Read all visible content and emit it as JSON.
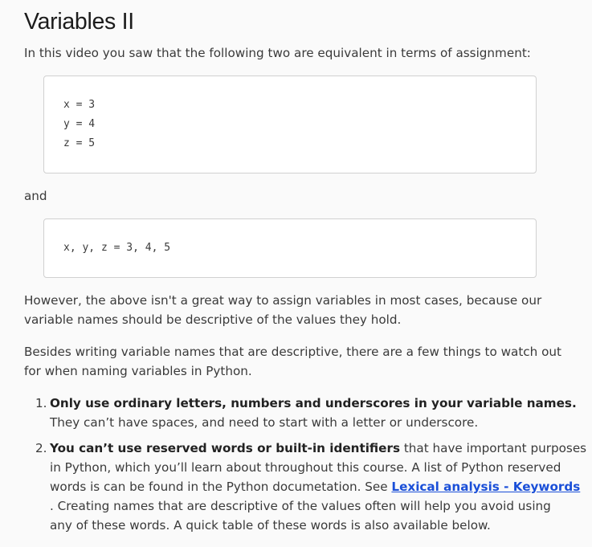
{
  "title": "Variables II",
  "intro": "In this video you saw that the following two are equivalent in terms of assignment:",
  "code_block_1": [
    "x = 3",
    "y = 4",
    "z = 5"
  ],
  "and_text": "and",
  "code_block_2": [
    "x, y, z = 3, 4, 5"
  ],
  "para_however": [
    "However, the above isn't a great way to assign variables in most cases, because our",
    "variable names should be descriptive of the values they hold."
  ],
  "para_besides": [
    "Besides writing variable names that are descriptive, there are a few things to watch out",
    "for when naming variables in Python."
  ],
  "list": {
    "item1": {
      "number": "1.",
      "bold": "Only use ordinary letters, numbers and underscores in your variable names.",
      "line2": "They can’t have spaces, and need to start with a letter or underscore."
    },
    "item2": {
      "number": "2.",
      "bold": "You can’t use reserved words or built-in identifiers",
      "line1_rest": " that have important purposes",
      "line2": "in Python, which you’ll learn about throughout this course. A list of Python reserved",
      "line3_pre": "words is can be found in the Python documetation. See ",
      "link_text": "Lexical analysis - Keywords",
      "line4": ". Creating names that are descriptive of the values often will help you avoid using",
      "line5": "any of these words. A quick table of these words is also available below."
    }
  },
  "colors": {
    "link": "#1a4fd8",
    "text": "#3a3a3a",
    "background": "#fafafa"
  }
}
